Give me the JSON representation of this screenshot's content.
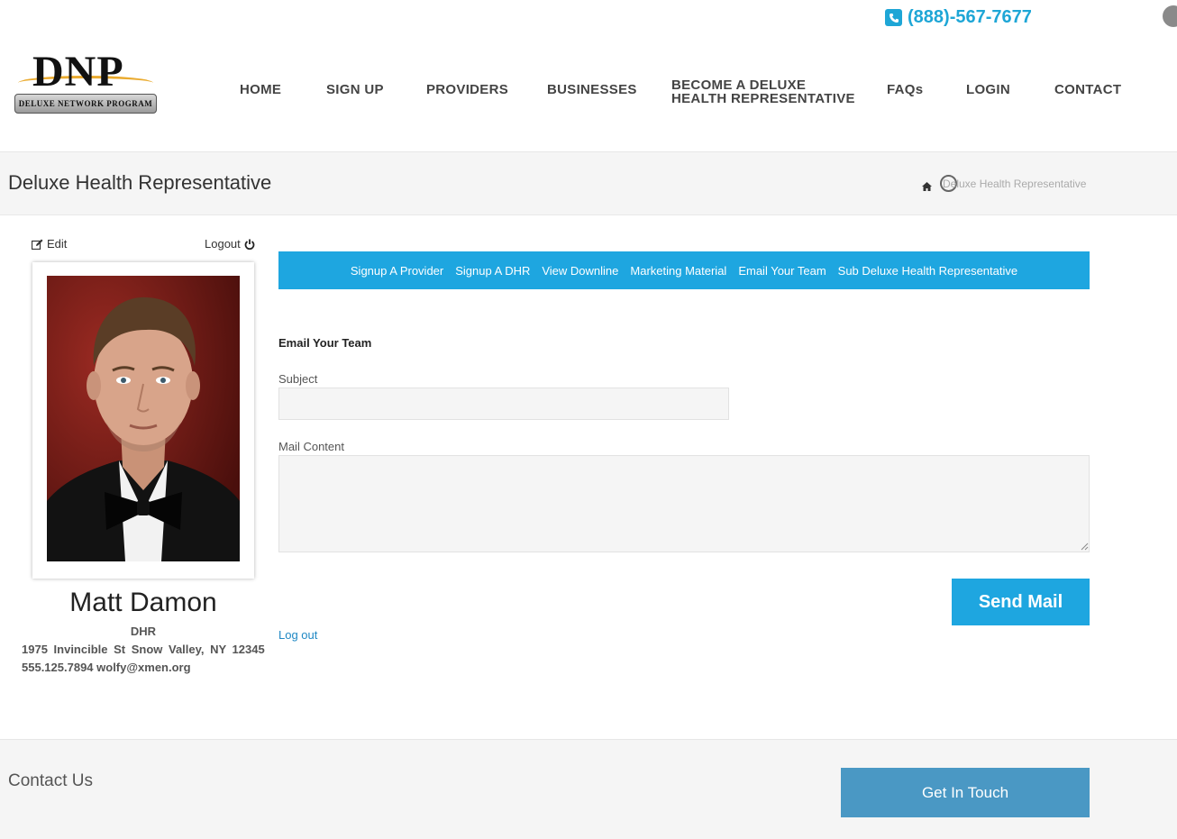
{
  "header": {
    "phone": "(888)-567-7677",
    "logo": {
      "text": "DNP",
      "subtitle": "DELUXE NETWORK PROGRAM"
    },
    "nav": [
      "HOME",
      "SIGN UP",
      "PROVIDERS",
      "BUSINESSES",
      "BECOME A DELUXE",
      "HEALTH REPRESENTATIVE",
      "FAQs",
      "LOGIN",
      "CONTACT"
    ]
  },
  "page": {
    "title": "Deluxe Health Representative",
    "breadcrumb": "Deluxe Health Representative"
  },
  "profile": {
    "edit_label": "Edit",
    "logout_label": "Logout",
    "name": "Matt Damon",
    "role": "DHR",
    "address": "1975 Invincible St Snow Valley, NY 12345",
    "contact": "555.125.7894 wolfy@xmen.org"
  },
  "tabs": [
    "Signup A Provider",
    "Signup A DHR",
    "View Downline",
    "Marketing Material",
    "Email Your Team",
    "Sub Deluxe Health Representative"
  ],
  "form": {
    "heading": "Email Your Team",
    "subject_label": "Subject",
    "subject_value": "",
    "content_label": "Mail Content",
    "content_value": "",
    "send_label": "Send Mail",
    "logout_link": "Log out"
  },
  "footer": {
    "title": "Contact Us",
    "button": "Get In Touch"
  },
  "colors": {
    "accent": "#1ea6e0",
    "footer_button": "#4a98c4",
    "link": "#1f88c4"
  }
}
